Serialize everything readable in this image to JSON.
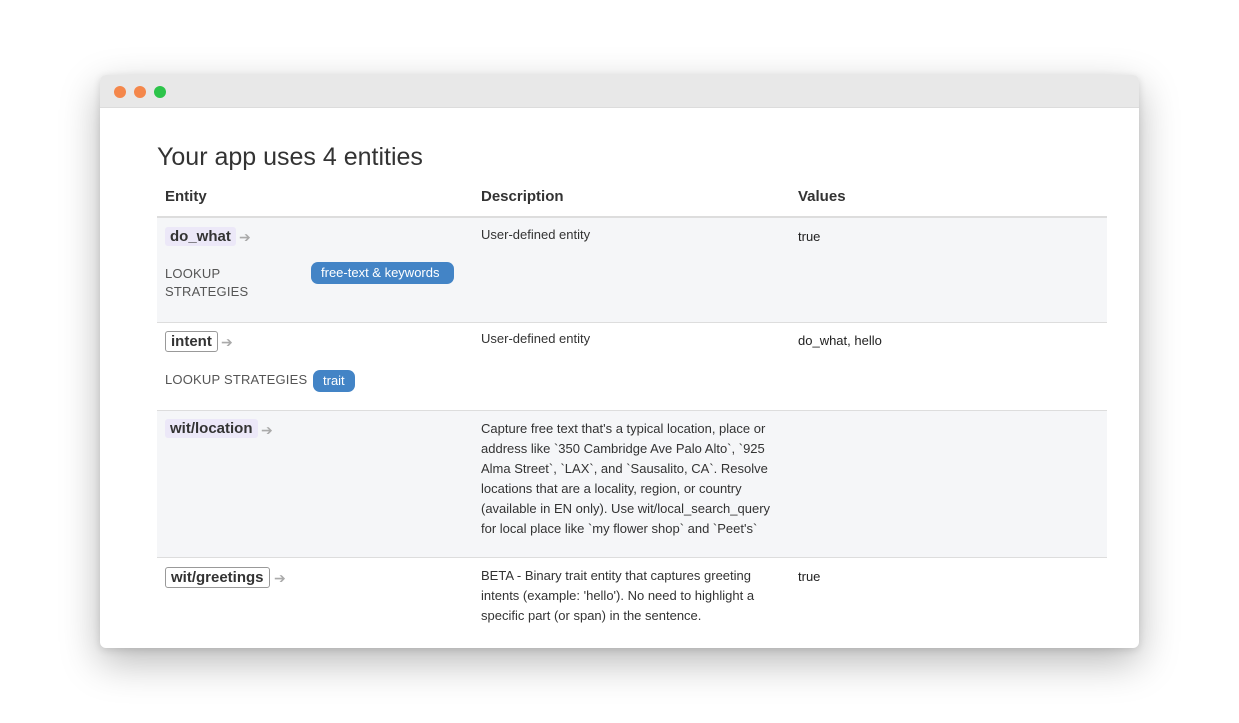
{
  "window": {
    "controls": [
      "close",
      "minimize",
      "maximize"
    ]
  },
  "page": {
    "title": "Your app uses 4 entities"
  },
  "table": {
    "headers": {
      "entity": "Entity",
      "description": "Description",
      "values": "Values"
    },
    "rows": [
      {
        "name": "do_what",
        "lookup_label": "LOOKUP STRATEGIES",
        "strategy": "free-text & keywords",
        "description": "User-defined entity",
        "values": "true"
      },
      {
        "name": "intent",
        "lookup_label": "LOOKUP STRATEGIES",
        "strategy": "trait",
        "description": "User-defined entity",
        "values": "do_what, hello"
      },
      {
        "name": "wit/location",
        "description": "Capture free text that's a typical location, place or address like `350 Cambridge Ave Palo Alto`, `925 Alma Street`, `LAX`, and `Sausalito, CA`. Resolve locations that are a locality, region, or country (available in EN only). Use wit/local_search_query for local place like `my flower shop` and `Peet's`",
        "values": ""
      },
      {
        "name": "wit/greetings",
        "description": "BETA - Binary trait entity that captures greeting intents (example: 'hello'). No need to highlight a specific part (or span) in the sentence.",
        "values": "true"
      }
    ]
  },
  "icons": {
    "entity_link": "arrow-right-icon"
  },
  "colors": {
    "badge": "#4384c6",
    "entity_highlight": "#ece8f8",
    "row_alt": "#f5f6f8",
    "close": "#f4874b",
    "minimize": "#f4874b",
    "maximize": "#2dc44a"
  }
}
